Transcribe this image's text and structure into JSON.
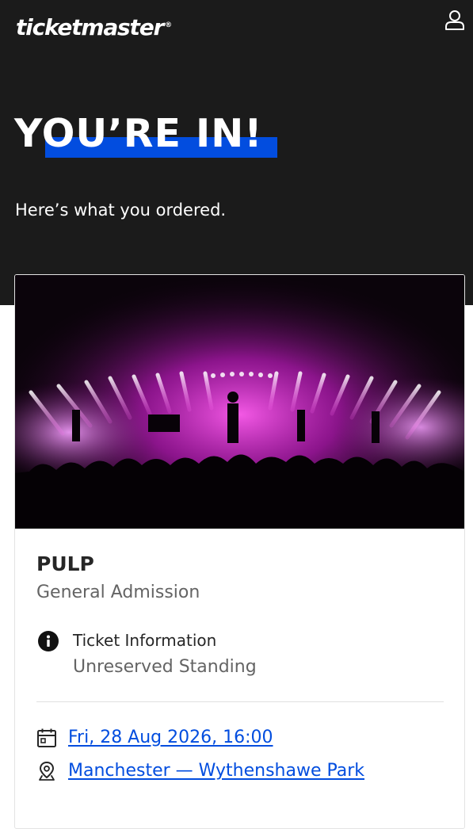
{
  "header": {
    "logo_text": "ticketmaster",
    "logo_mark": "®",
    "account_icon": "user-icon",
    "background_color": "#1b1b1b",
    "accent_color": "#024ddf"
  },
  "hero": {
    "title": "YOU’RE IN!",
    "subtitle": "Here’s what you ordered."
  },
  "order": {
    "image": "concert-stage-photo",
    "event_name": "PULP",
    "ticket_type": "General Admission",
    "ticket_info": {
      "icon": "info-icon",
      "label": "Ticket Information",
      "value": "Unreserved Standing"
    },
    "date": {
      "icon": "calendar-icon",
      "text": "Fri, 28 Aug 2026, 16:00"
    },
    "venue": {
      "icon": "location-pin-icon",
      "text": "Manchester — Wythenshawe Park"
    }
  }
}
